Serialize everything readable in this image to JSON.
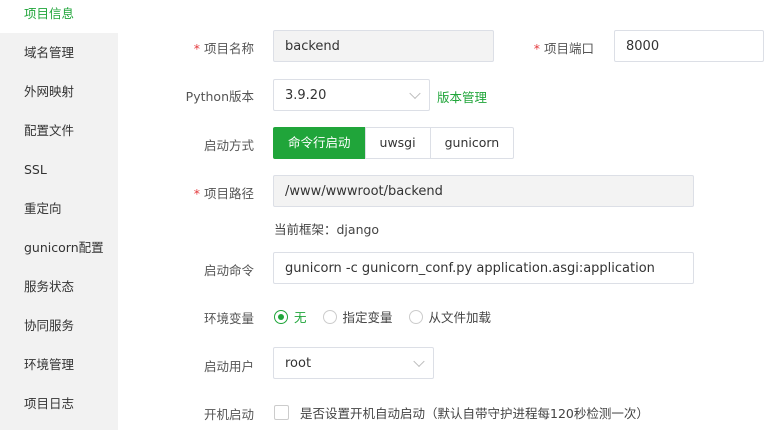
{
  "sidebar": {
    "items": [
      {
        "label": "项目信息",
        "active": true
      },
      {
        "label": "域名管理"
      },
      {
        "label": "外网映射"
      },
      {
        "label": "配置文件"
      },
      {
        "label": "SSL"
      },
      {
        "label": "重定向"
      },
      {
        "label": "gunicorn配置"
      },
      {
        "label": "服务状态"
      },
      {
        "label": "协同服务"
      },
      {
        "label": "环境管理"
      },
      {
        "label": "项目日志"
      }
    ]
  },
  "form": {
    "required_mark": "*",
    "project_name": {
      "label": "项目名称",
      "value": "backend"
    },
    "project_port": {
      "label": "项目端口",
      "value": "8000"
    },
    "python_version": {
      "label": "Python版本",
      "value": "3.9.20",
      "link": "版本管理"
    },
    "start_mode": {
      "label": "启动方式",
      "options": [
        "命令行启动",
        "uwsgi",
        "gunicorn"
      ],
      "selected": "命令行启动"
    },
    "project_path": {
      "label": "项目路径",
      "value": "/www/wwwroot/backend"
    },
    "framework_hint": "当前框架：django",
    "start_command": {
      "label": "启动命令",
      "value": "gunicorn -c gunicorn_conf.py application.asgi:application"
    },
    "env_vars": {
      "label": "环境变量",
      "options": [
        "无",
        "指定变量",
        "从文件加载"
      ],
      "selected": "无"
    },
    "start_user": {
      "label": "启动用户",
      "value": "root"
    },
    "autostart": {
      "label": "开机启动",
      "text": "是否设置开机自动启动（默认自带守护进程每120秒检测一次）",
      "checked": false
    }
  },
  "colors": {
    "accent": "#20a53a",
    "required": "#e4393c"
  }
}
